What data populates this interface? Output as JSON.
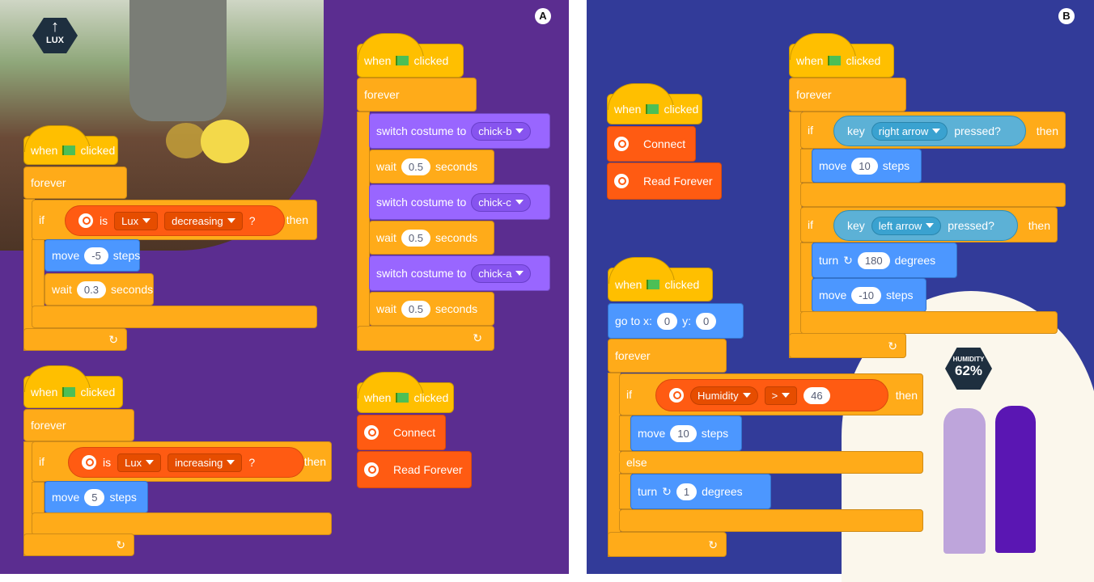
{
  "panels": {
    "a_label": "A",
    "b_label": "B"
  },
  "lux_badge": {
    "label": "LUX"
  },
  "humidity_badge": {
    "label": "HUMIDITY",
    "value": "62%"
  },
  "text": {
    "when": "when",
    "clicked": "clicked",
    "forever": "forever",
    "if": "if",
    "then": "then",
    "else": "else",
    "is": "is",
    "q": "?",
    "move": "move",
    "steps": "steps",
    "wait": "wait",
    "seconds": "seconds",
    "switch_costume": "switch costume to",
    "connect": "Connect",
    "read_forever": "Read Forever",
    "key": "key",
    "pressed": "pressed?",
    "turn": "turn",
    "degrees": "degrees",
    "goto_x": "go to x:",
    "y": "y:"
  },
  "values": {
    "lux": "Lux",
    "decreasing": "decreasing",
    "increasing": "increasing",
    "move_neg5": "-5",
    "wait_03": "0.3",
    "move_5": "5",
    "chick_b": "chick-b",
    "chick_c": "chick-c",
    "chick_a": "chick-a",
    "wait_05": "0.5",
    "right_arrow": "right arrow",
    "left_arrow": "left arrow",
    "move_10": "10",
    "move_neg10": "-10",
    "turn_180": "180",
    "x0": "0",
    "y0": "0",
    "humidity": "Humidity",
    "gt": ">",
    "hum_val": "46",
    "turn_1": "1"
  },
  "colors": {
    "panel_a": "#5b2d90",
    "panel_b": "#323b99",
    "events": "#ffbf00",
    "control": "#ffab19",
    "motion": "#4c97ff",
    "looks": "#9966ff",
    "extension": "#ff5b12",
    "sensing": "#5cb1d6"
  }
}
